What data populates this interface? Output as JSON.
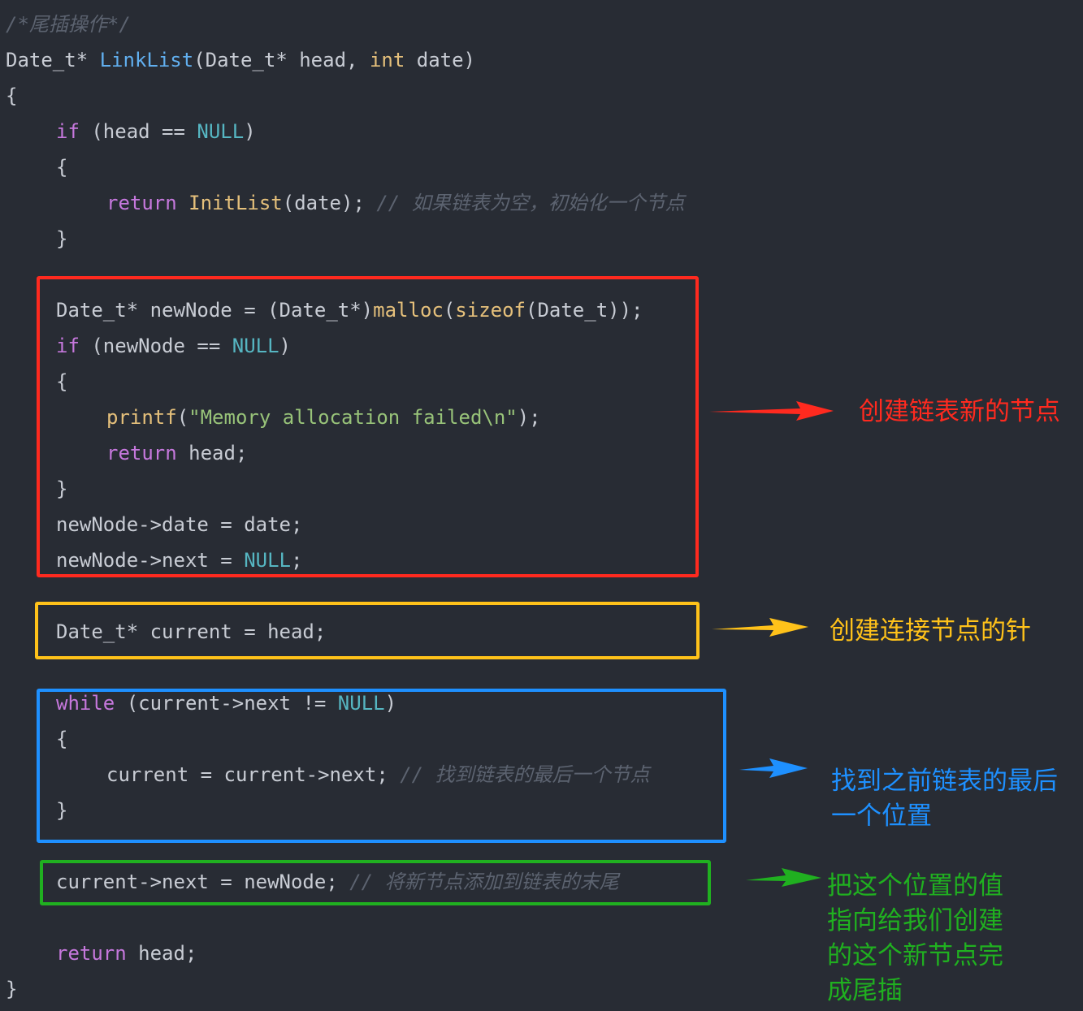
{
  "code": {
    "comment_header": "/*尾插操作*/",
    "signature": {
      "ret_type": "Date_t* ",
      "func_name": "LinkList",
      "open": "(Date_t* head, ",
      "int_kw": "int",
      "close": " date)"
    },
    "brace_open": "{",
    "if1": {
      "kw": "if",
      "mid": " (head == ",
      "null": "NULL",
      "end": ")"
    },
    "brace1_open": "{",
    "return_init": {
      "kw": "return",
      "sp": " ",
      "fn": "InitList",
      "args": "(date); ",
      "comment": "// 如果链表为空，初始化一个节点"
    },
    "brace1_close": "}",
    "alloc": {
      "a": "Date_t* newNode = (Date_t*)",
      "malloc": "malloc",
      "p": "(",
      "sizeof": "sizeof",
      "b": "(Date_t));"
    },
    "if2": {
      "kw": "if",
      "mid": " (newNode == ",
      "null": "NULL",
      "end": ")"
    },
    "brace2_open": "{",
    "printf_line": {
      "fn": "printf",
      "p": "(",
      "str": "\"Memory allocation failed\\n\"",
      "end": ");"
    },
    "return_head_inner": {
      "kw": "return",
      "rest": " head;"
    },
    "brace2_close": "}",
    "assign_date": "newNode->date = date;",
    "assign_next": {
      "a": "newNode->next = ",
      "null": "NULL",
      "end": ";"
    },
    "current_decl": "Date_t* current = head;",
    "while_line": {
      "kw": "while",
      "mid": " (current->next != ",
      "null": "NULL",
      "end": ")"
    },
    "brace3_open": "{",
    "advance": {
      "code": "current = current->next; ",
      "comment": "// 找到链表的最后一个节点"
    },
    "brace3_close": "}",
    "link": {
      "code": "current->next = newNode; ",
      "comment": "// 将新节点添加到链表的末尾"
    },
    "return_head": {
      "kw": "return",
      "rest": " head;"
    },
    "brace_close": "}"
  },
  "annotations": {
    "red": "创建链表新的节点",
    "orange": "创建连接节点的针",
    "blue": "找到之前链表的最后\n一个位置",
    "green": "把这个位置的值\n指向给我们创建\n的这个新节点完\n成尾插"
  },
  "colors": {
    "red": "#ff2a1f",
    "orange": "#ffc21a",
    "blue": "#1e90ff",
    "green": "#20b020"
  }
}
